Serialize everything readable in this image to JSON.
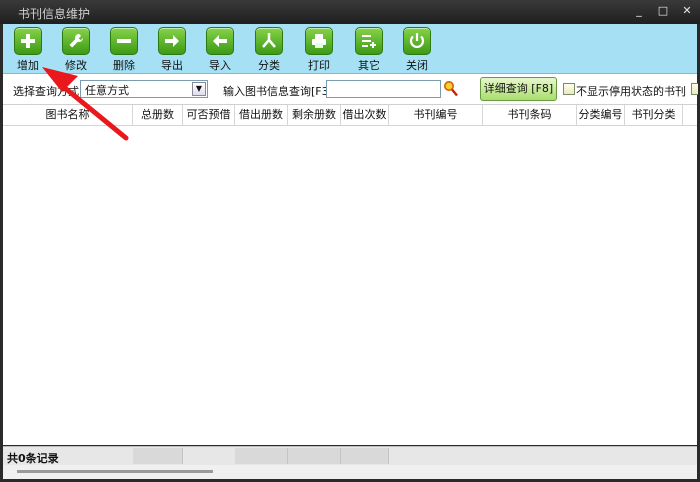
{
  "window": {
    "title": "书刊信息维护",
    "controls": [
      "_",
      "□",
      "✕"
    ]
  },
  "toolbar": {
    "buttons": [
      {
        "label": "增加",
        "icon": "plus-icon"
      },
      {
        "label": "修改",
        "icon": "wrench-icon"
      },
      {
        "label": "删除",
        "icon": "minus-icon"
      },
      {
        "label": "导出",
        "icon": "arrow-right-icon"
      },
      {
        "label": "导入",
        "icon": "arrow-left-icon"
      },
      {
        "label": "分类",
        "icon": "split-icon"
      },
      {
        "label": "打印",
        "icon": "printer-icon"
      },
      {
        "label": "其它",
        "icon": "list-add-icon"
      },
      {
        "label": "关闭",
        "icon": "power-icon"
      }
    ]
  },
  "search": {
    "select_label": "选择查询方式",
    "select_value": "任意方式",
    "input_label": "输入图书信息查询[F3]:",
    "input_value": "",
    "detail_button": "详细查询 [F8]",
    "hide_disabled_label": "不显示停用状态的书刊"
  },
  "table": {
    "columns": [
      "图书名称",
      "总册数",
      "可否预借",
      "借出册数",
      "剩余册数",
      "借出次数",
      "书刊编号",
      "书刊条码",
      "分类编号",
      "书刊分类"
    ]
  },
  "status": {
    "text": "共0条记录"
  },
  "colors": {
    "toolbar_bg": "#a5e0f4",
    "icon_green": "#5cb52a",
    "annotation_red": "#e8181c"
  }
}
